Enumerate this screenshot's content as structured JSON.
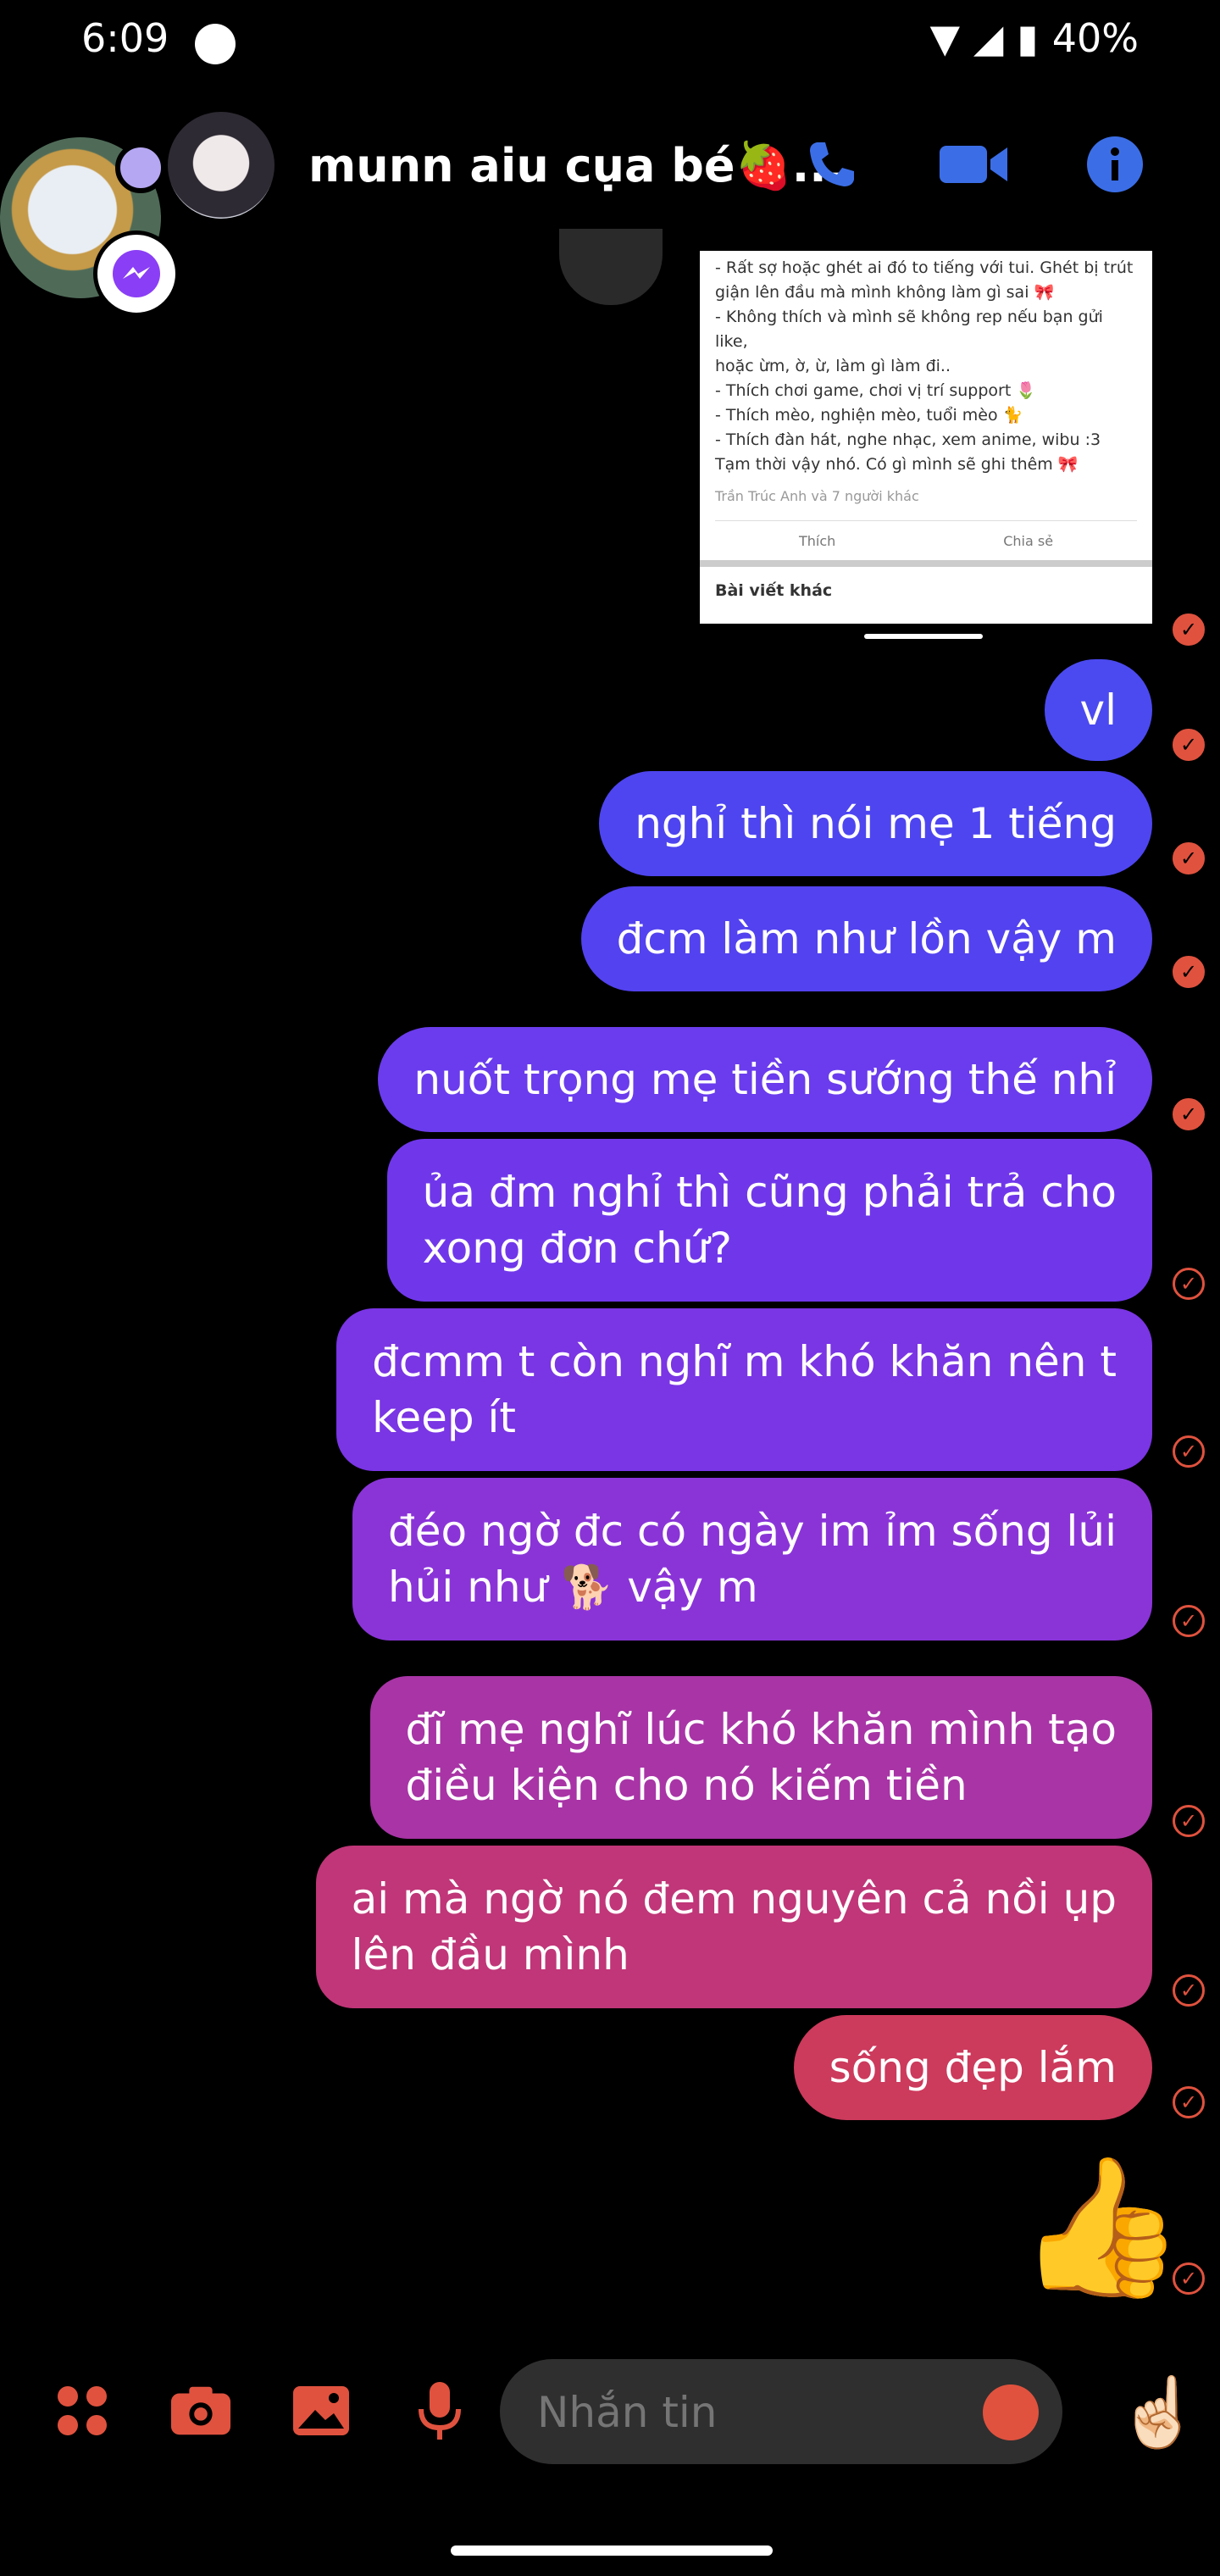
{
  "status_bar": {
    "time": "6:09",
    "battery": "40%"
  },
  "header": {
    "title": "munn aiu cụa bé🍓...",
    "icons": [
      "phone-icon",
      "video-icon",
      "info-icon"
    ]
  },
  "shared_image": {
    "lines": [
      "- Rất sợ hoặc ghét ai đó to tiếng với tui. Ghét bị trút",
      "giận lên đầu mà mình không làm gì sai 🎀",
      "- Không thích và mình sẽ không rep nếu bạn gửi like,",
      "hoặc ừm, ờ, ừ, làm gì làm đi..",
      "- Thích chơi game, chơi vị trí support 🌷",
      "- Thích mèo, nghiện mèo, tuổi mèo 🐈",
      "- Thích đàn hát, nghe nhạc, xem anime, wibu :3",
      "Tạm thời vậy nhó. Có gì mình sẽ ghi thêm 🎀"
    ],
    "reactions": "Trần Trúc Anh và 7 người khác",
    "like_label": "Thích",
    "share_label": "Chia sẻ",
    "other_posts": "Bài viết khác"
  },
  "messages": [
    {
      "text": "vl"
    },
    {
      "text": "nghỉ thì nói mẹ 1 tiếng"
    },
    {
      "text": "đcm làm như lồn vậy m"
    },
    {
      "text": "nuốt trọng mẹ tiền sướng thế nhỉ"
    },
    {
      "text": "ủa đm nghỉ thì cũng phải trả cho\nxong đơn chứ?"
    },
    {
      "text": "đcmm t còn nghĩ m khó khăn nên t\nkeep ít"
    },
    {
      "text": "đéo ngờ đc có ngày im ỉm sống lủi\nhủi như 🐕 vậy m"
    },
    {
      "text": "đĩ mẹ nghĩ lúc khó khăn mình tạo\nđiều kiện cho nó kiếm tiền"
    },
    {
      "text": "ai mà ngờ nó đem nguyên cả nồi ụp\nlên đầu mình"
    },
    {
      "text": "sống đẹp lắm"
    },
    {
      "text": "👍"
    }
  ],
  "composer": {
    "placeholder": "Nhắn tin",
    "hand": "☝🏻"
  },
  "colors": {
    "accent": "#e0523e",
    "header_icons": "#3b6ee6"
  }
}
